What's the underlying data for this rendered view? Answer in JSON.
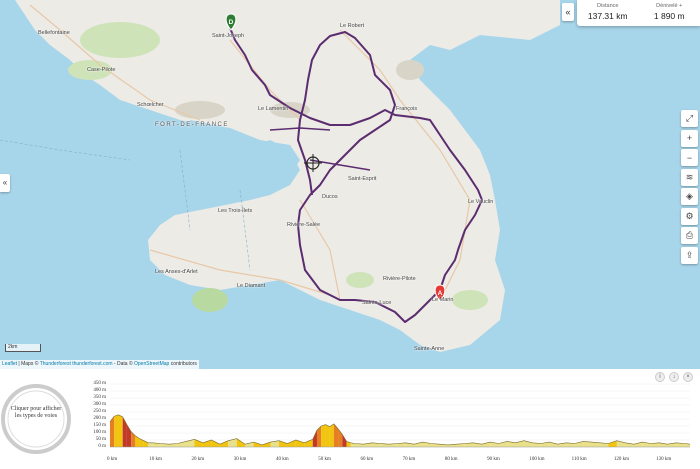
{
  "stats": {
    "distance_label": "Distance",
    "distance_value": "137.31 km",
    "elevation_label": "Dénivelé +",
    "elevation_value": "1 890 m"
  },
  "markers": {
    "start": "D",
    "end": "A"
  },
  "places": {
    "saint_joseph": "Saint-Joseph",
    "le_robert": "Le Robert",
    "bellefontaine": "Bellefontaine",
    "case_pilote": "Case-Pilote",
    "schoelcher": "Schœlcher",
    "le_lamentin": "Le Lamentin",
    "fort_de_france": "FORT-DE-FRANCE",
    "le_francois": "François",
    "saint_esprit": "Saint-Esprit",
    "ducos": "Ducos",
    "le_vauclin": "Le Vauclin",
    "les_trois_ilets": "Les Trois-Îlets",
    "riviere_salee": "Rivière-Salée",
    "les_anses_d_arlet": "Les Anses-d'Arlet",
    "riviere_pilote": "Rivière-Pilote",
    "le_diamant": "Le Diamant",
    "sainte_luce": "Sainte-Luce",
    "le_marin": "Le Marin",
    "sainte_anne": "Sainte-Anne"
  },
  "scale_label": "2km",
  "attribution": {
    "leaflet": "Leaflet",
    "maps_text": " | Maps © ",
    "thunderforest": "Thunderforest",
    "thunderforest_link": "thunderforest.com",
    "data_text": " - Data © ",
    "osm": "OpenStreetMap",
    "contributors": " contributors"
  },
  "toolbar_icons": [
    "fullscreen-icon",
    "zoom-in-icon",
    "zoom-out-icon",
    "layers-icon",
    "overlay-icon",
    "settings-icon",
    "print-icon",
    "share-icon"
  ],
  "profile": {
    "circle_text": "Cliquer pour afficher les types de voies",
    "y_ticks": [
      "450 m",
      "400 m",
      "350 m",
      "300 m",
      "250 m",
      "200 m",
      "150 m",
      "100 m",
      "50 m",
      "0 m"
    ],
    "x_ticks": [
      "0 km",
      "10 km",
      "20 km",
      "30 km",
      "40 km",
      "50 km",
      "60 km",
      "70 km",
      "80 km",
      "90 km",
      "100 km",
      "110 km",
      "120 km",
      "130 km"
    ]
  },
  "chart_data": {
    "type": "area",
    "ylim": [
      0,
      450
    ],
    "xlim": [
      0,
      137.31
    ],
    "x": [
      0,
      1,
      2,
      3,
      4,
      5,
      6,
      7,
      8,
      9,
      10,
      12,
      14,
      16,
      18,
      20,
      22,
      24,
      26,
      28,
      30,
      32,
      34,
      36,
      38,
      40,
      42,
      44,
      46,
      48,
      49,
      50,
      51,
      52,
      53,
      54,
      55,
      56,
      57,
      58,
      60,
      62,
      64,
      66,
      68,
      70,
      72,
      74,
      76,
      78,
      80,
      82,
      84,
      86,
      88,
      90,
      92,
      94,
      96,
      98,
      100,
      102,
      104,
      106,
      108,
      110,
      112,
      114,
      116,
      118,
      120,
      122,
      124,
      126,
      128,
      130,
      132,
      134,
      136,
      137.31
    ],
    "y": [
      180,
      220,
      230,
      215,
      160,
      110,
      80,
      60,
      45,
      30,
      30,
      25,
      20,
      25,
      40,
      55,
      30,
      50,
      20,
      45,
      60,
      20,
      35,
      15,
      35,
      45,
      25,
      50,
      30,
      55,
      120,
      150,
      160,
      145,
      165,
      130,
      90,
      40,
      30,
      25,
      20,
      30,
      25,
      20,
      25,
      30,
      20,
      35,
      25,
      20,
      15,
      20,
      25,
      30,
      20,
      35,
      25,
      40,
      30,
      45,
      30,
      25,
      35,
      20,
      30,
      25,
      40,
      35,
      30,
      25,
      45,
      30,
      20,
      35,
      25,
      30,
      20,
      30,
      25,
      20
    ]
  }
}
